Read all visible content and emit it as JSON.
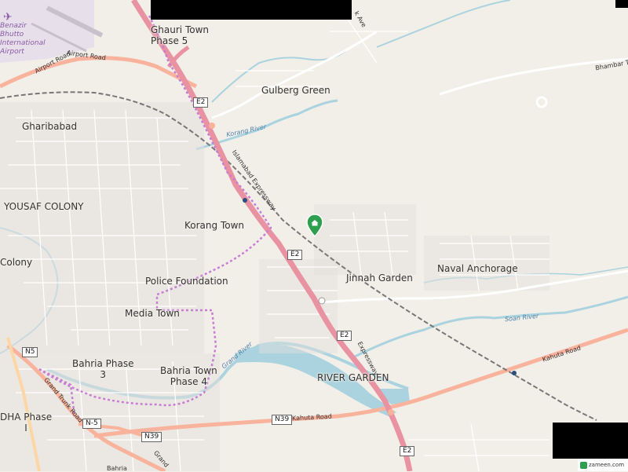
{
  "places": {
    "ghauri_town": "Ghauri Town",
    "ghauri_town_phase": "Phase 5",
    "gulberg_green": "Gulberg Green",
    "ghaibabad": "Gharibabad",
    "yousaf_colony": "YOUSAF COLONY",
    "korang_town": "Korang Town",
    "jinnah_garden": "Jinnah Garden",
    "naval_anchorage": "Naval Anchorage",
    "colony": "Colony",
    "police_foundation": "Police Foundation",
    "media_town": "Media Town",
    "bahria_phase_3": "Bahria Phase",
    "bahria_phase_3_num": "3",
    "bahria_town_phase_4": "Bahria Town",
    "bahria_town_phase_4_num": "Phase 4",
    "river_garden": "RIVER GARDEN",
    "dha_phase": "DHA Phase",
    "dha_phase_num": "I"
  },
  "airport": {
    "line1": "Benazir",
    "line2": "Bhutto",
    "line3": "International",
    "line4": "Airport"
  },
  "roads": {
    "airport_road_1": "Airport Road",
    "airport_road_2": "Airport Road",
    "islamabad_expressway": "Islamabad Expressway",
    "expressway_2": "Expressway",
    "kahuta_road_1": "Kahuta Road",
    "kahuta_road_2": "Kahuta Road",
    "grand_trunk_road_1": "Grand Trunk Road",
    "grand_trunk_road_2": "Grand",
    "bhambar_road": "Bhambar Tar",
    "park_ave": "k Ave"
  },
  "rivers": {
    "korang_river": "Korang River",
    "soan_river": "Soan River",
    "grand_river": "Grand River"
  },
  "shields": {
    "e2_a": "E2",
    "e2_b": "E2",
    "e2_c": "E2",
    "e2_d": "E2",
    "n5_a": "N5",
    "n5_b": "N-5",
    "n39_a": "N39",
    "n39_b": "N39"
  },
  "partial": {
    "bahria_bottom": "Bahria"
  },
  "logo": {
    "text": "zameen.com"
  },
  "colors": {
    "background": "#f2efe9",
    "water": "#aad3df",
    "motorway": "#e892a2",
    "trunk": "#f9b29c",
    "railway": "#777777",
    "boundary": "#c77dd3",
    "pin": "#2e9e4f"
  }
}
